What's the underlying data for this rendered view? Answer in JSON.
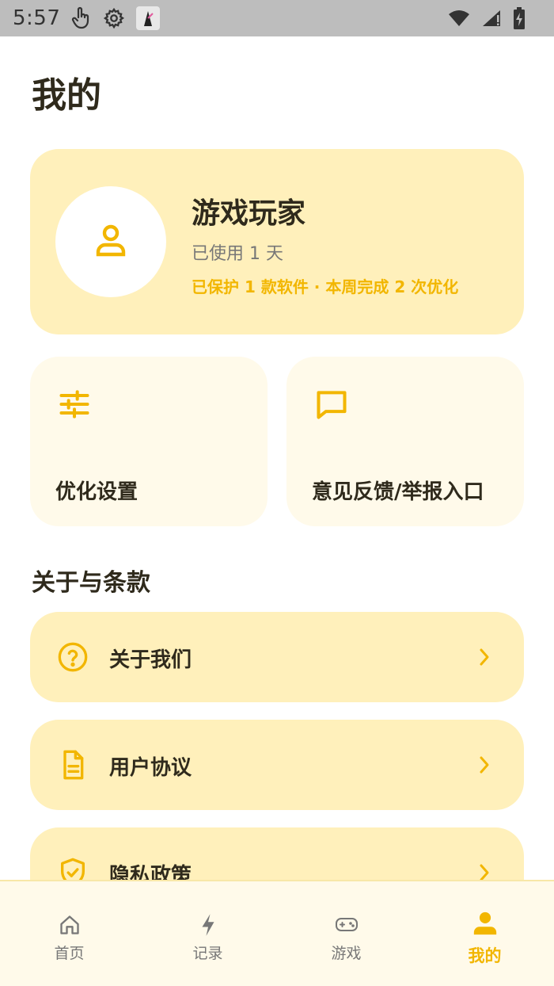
{
  "status_bar": {
    "time": "5:57",
    "left_icons": [
      "touch-icon",
      "gear-icon",
      "app-badge-icon"
    ],
    "right_icons": [
      "wifi-icon",
      "signal-icon",
      "battery-charging-icon"
    ]
  },
  "page": {
    "title": "我的"
  },
  "profile": {
    "name": "游戏玩家",
    "days_used": "已使用 1 天",
    "stats": "已保护 1 款软件 · 本周完成 2 次优化",
    "avatar_icon": "user-outline-icon"
  },
  "quick_actions": [
    {
      "label": "优化设置",
      "icon": "sliders-icon"
    },
    {
      "label": "意见反馈/举报入口",
      "icon": "message-square-icon"
    }
  ],
  "about_section": {
    "title": "关于与条款",
    "items": [
      {
        "label": "关于我们",
        "icon": "help-circle-icon"
      },
      {
        "label": "用户协议",
        "icon": "document-icon"
      },
      {
        "label": "隐私政策",
        "icon": "shield-check-icon"
      }
    ]
  },
  "bottom_nav": {
    "items": [
      {
        "label": "首页",
        "icon": "home-icon",
        "active": false
      },
      {
        "label": "记录",
        "icon": "lightning-icon",
        "active": false
      },
      {
        "label": "游戏",
        "icon": "gamepad-icon",
        "active": false
      },
      {
        "label": "我的",
        "icon": "person-filled-icon",
        "active": true
      }
    ]
  },
  "colors": {
    "accent": "#f2b600",
    "card_bg": "#fff0bb",
    "tile_bg": "#fffaea",
    "status_bar_bg": "#bdbdbd",
    "text_primary": "#2f2a1c"
  }
}
